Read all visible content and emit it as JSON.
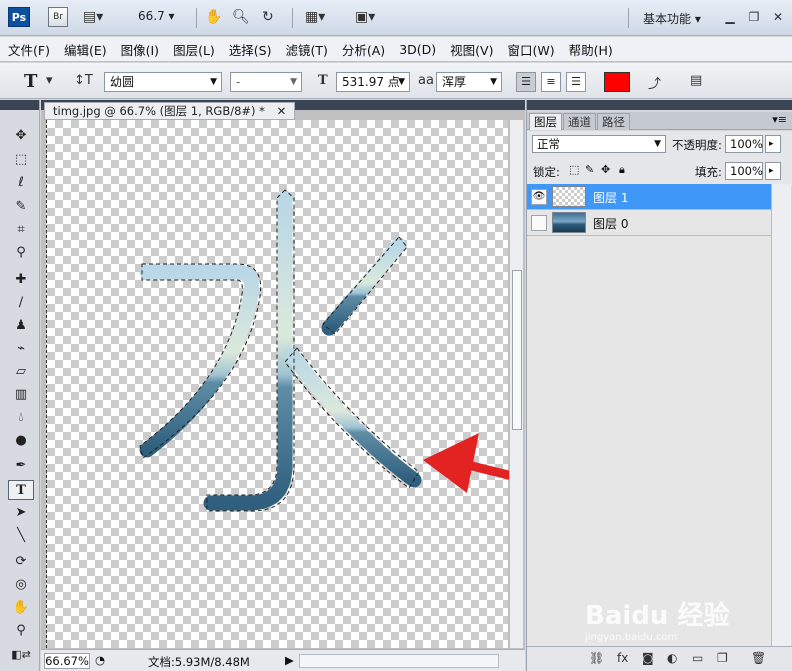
{
  "appbar": {
    "logo": "Ps",
    "bridge_label": "Br",
    "zoom": "66.7",
    "workspace": "基本功能",
    "icons": [
      "film-icon",
      "hand-icon",
      "zoom-icon",
      "rotate-icon",
      "layout-icon",
      "screen-mode-icon"
    ]
  },
  "menu": [
    "文件(F)",
    "编辑(E)",
    "图像(I)",
    "图层(L)",
    "选择(S)",
    "滤镜(T)",
    "分析(A)",
    "3D(D)",
    "视图(V)",
    "窗口(W)",
    "帮助(H)"
  ],
  "options": {
    "tool_letter": "T",
    "font_family": "幼圆",
    "font_style": "-",
    "font_size": "531.97 点",
    "aa_label": "aa",
    "antialias": "浑厚",
    "text_color": "#ff0000"
  },
  "document": {
    "tab_title": "timg.jpg @ 66.7% (图层 1, RGB/8#) *",
    "glyph": "水"
  },
  "status": {
    "zoom": "66.67%",
    "doc_info": "文档:5.93M/8.48M"
  },
  "panel": {
    "tabs": [
      "图层",
      "通道",
      "路径"
    ],
    "blend_mode": "正常",
    "opacity_label": "不透明度:",
    "opacity_value": "100%",
    "lock_label": "锁定:",
    "fill_label": "填充:",
    "fill_value": "100%",
    "layers": [
      {
        "name": "图层 1",
        "visible": true,
        "selected": true
      },
      {
        "name": "图层 0",
        "visible": false,
        "selected": false
      }
    ]
  },
  "watermark": "Baidu 经验",
  "watermark_url": "jingyan.baidu.com"
}
